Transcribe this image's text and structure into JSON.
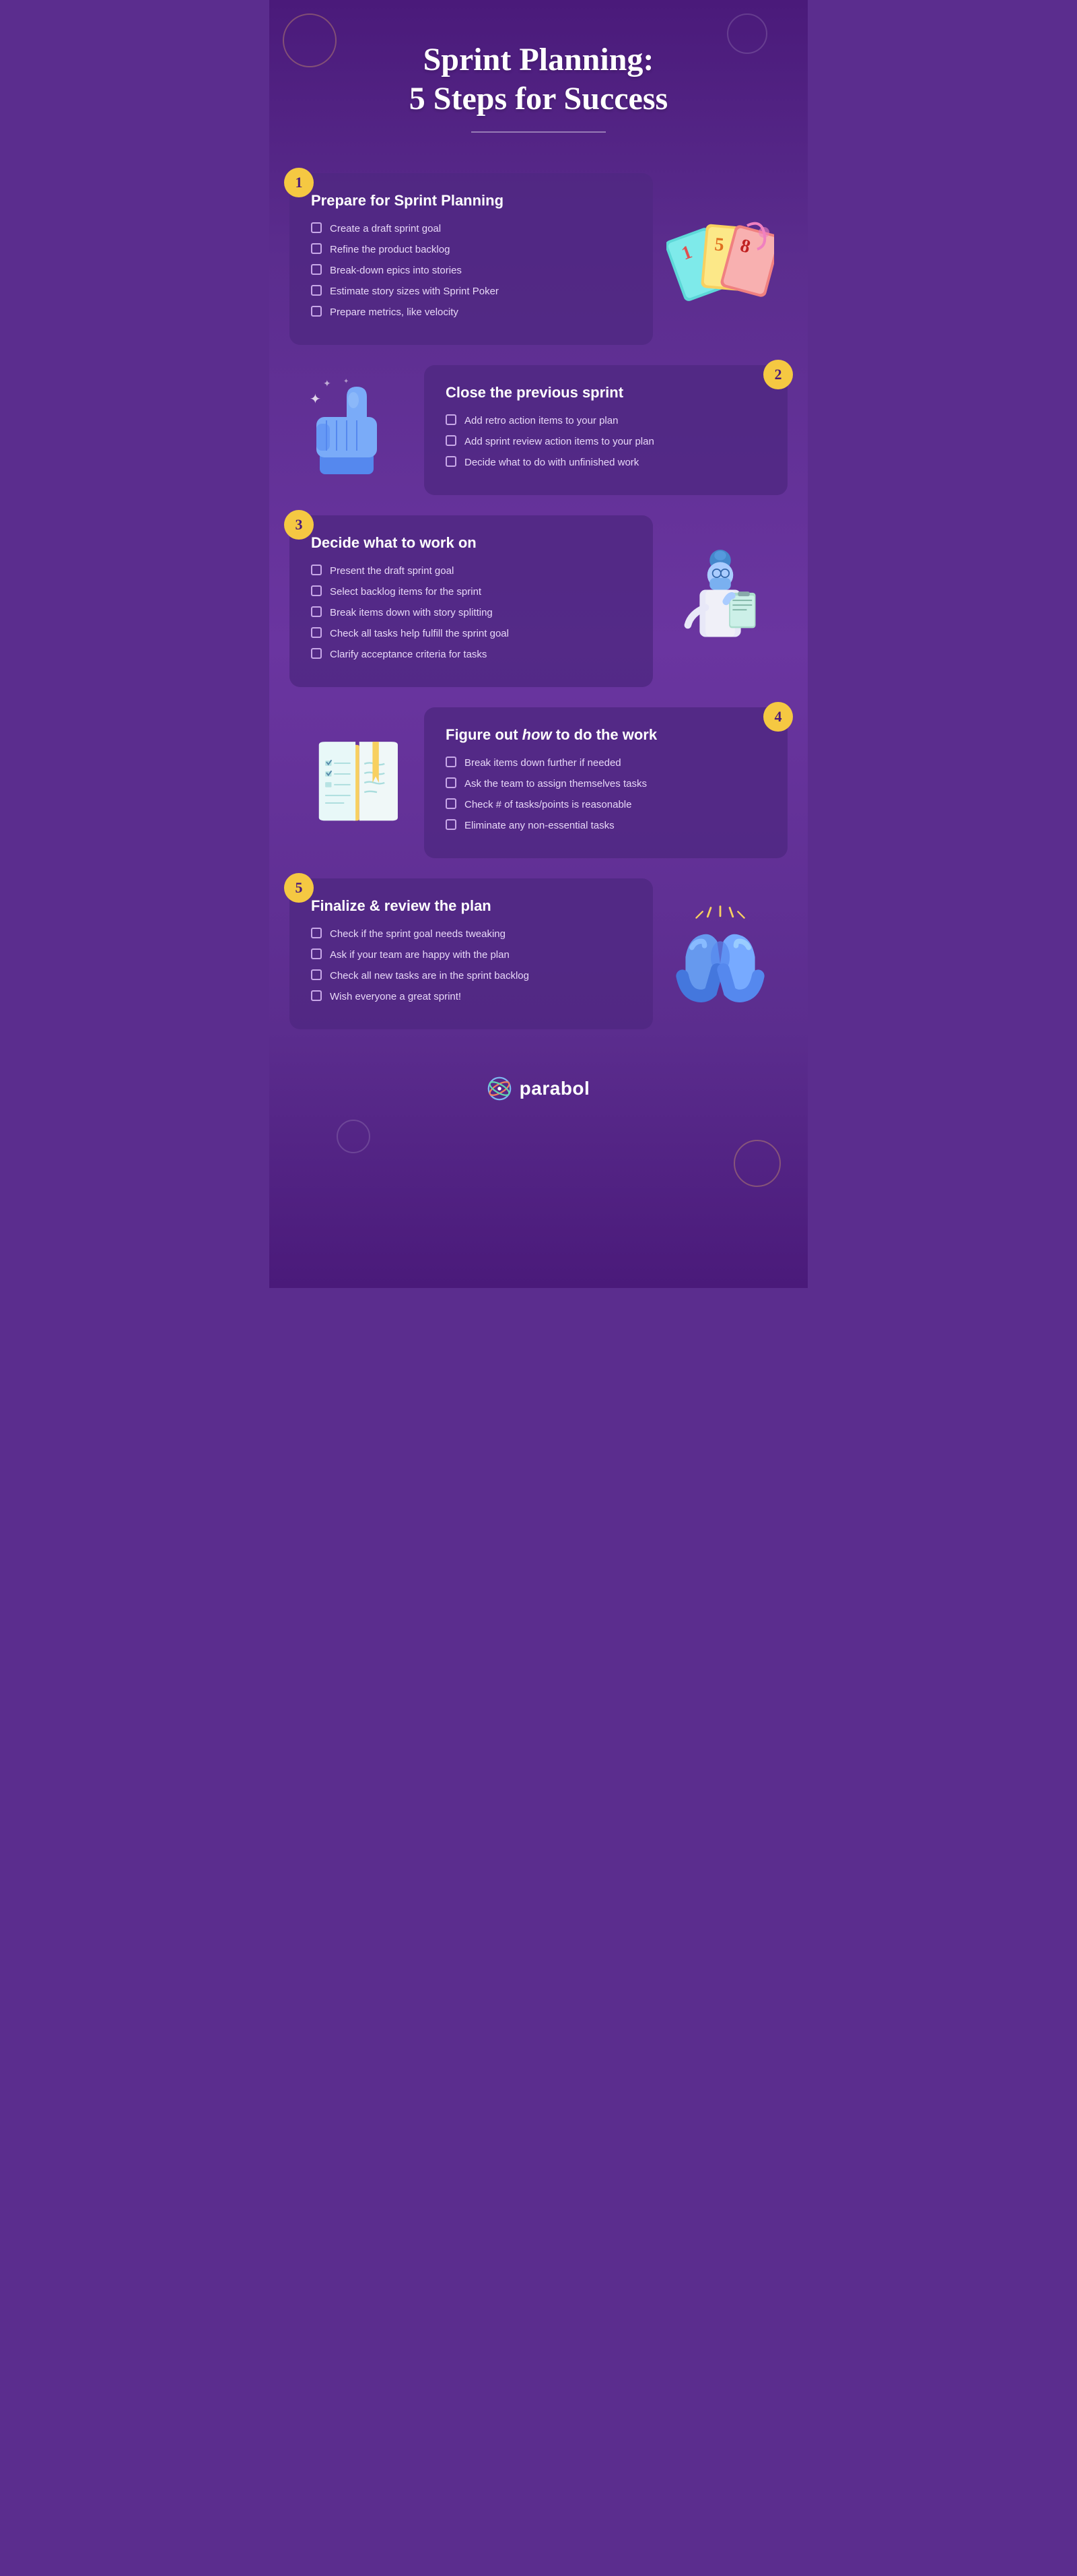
{
  "page": {
    "background_color": "#5b2d8e",
    "title_line1": "Sprint Planning:",
    "title_line2": "5 Steps for Success"
  },
  "steps": [
    {
      "number": "1",
      "title": "Prepare for Sprint Planning",
      "items": [
        "Create a draft sprint goal",
        "Refine the product backlog",
        "Break-down epics into stories",
        "Estimate story sizes with Sprint Poker",
        "Prepare metrics, like velocity"
      ],
      "illustration": "cards"
    },
    {
      "number": "2",
      "title": "Close the previous sprint",
      "items": [
        "Add retro action items to your plan",
        "Add sprint review action items to your plan",
        "Decide what to do with unfinished work"
      ],
      "illustration": "thumbsup"
    },
    {
      "number": "3",
      "title": "Decide what to work on",
      "items": [
        "Present the draft sprint goal",
        "Select backlog items for the sprint",
        "Break items down with story splitting",
        "Check all tasks help fulfill the sprint goal",
        "Clarify acceptance criteria for tasks"
      ],
      "illustration": "person"
    },
    {
      "number": "4",
      "title_prefix": "Figure out ",
      "title_italic": "how",
      "title_suffix": " to do the work",
      "items": [
        "Break items down further if needed",
        "Ask the team to assign themselves tasks",
        "Check # of tasks/points is reasonable",
        "Eliminate any non-essential tasks"
      ],
      "illustration": "notebook"
    },
    {
      "number": "5",
      "title": "Finalize & review the plan",
      "items": [
        "Check if the sprint goal needs tweaking",
        "Ask if your team are happy with the plan",
        "Check all new tasks are in the sprint backlog",
        "Wish everyone a great sprint!"
      ],
      "illustration": "clapping"
    }
  ],
  "logo": {
    "text": "parabol"
  }
}
